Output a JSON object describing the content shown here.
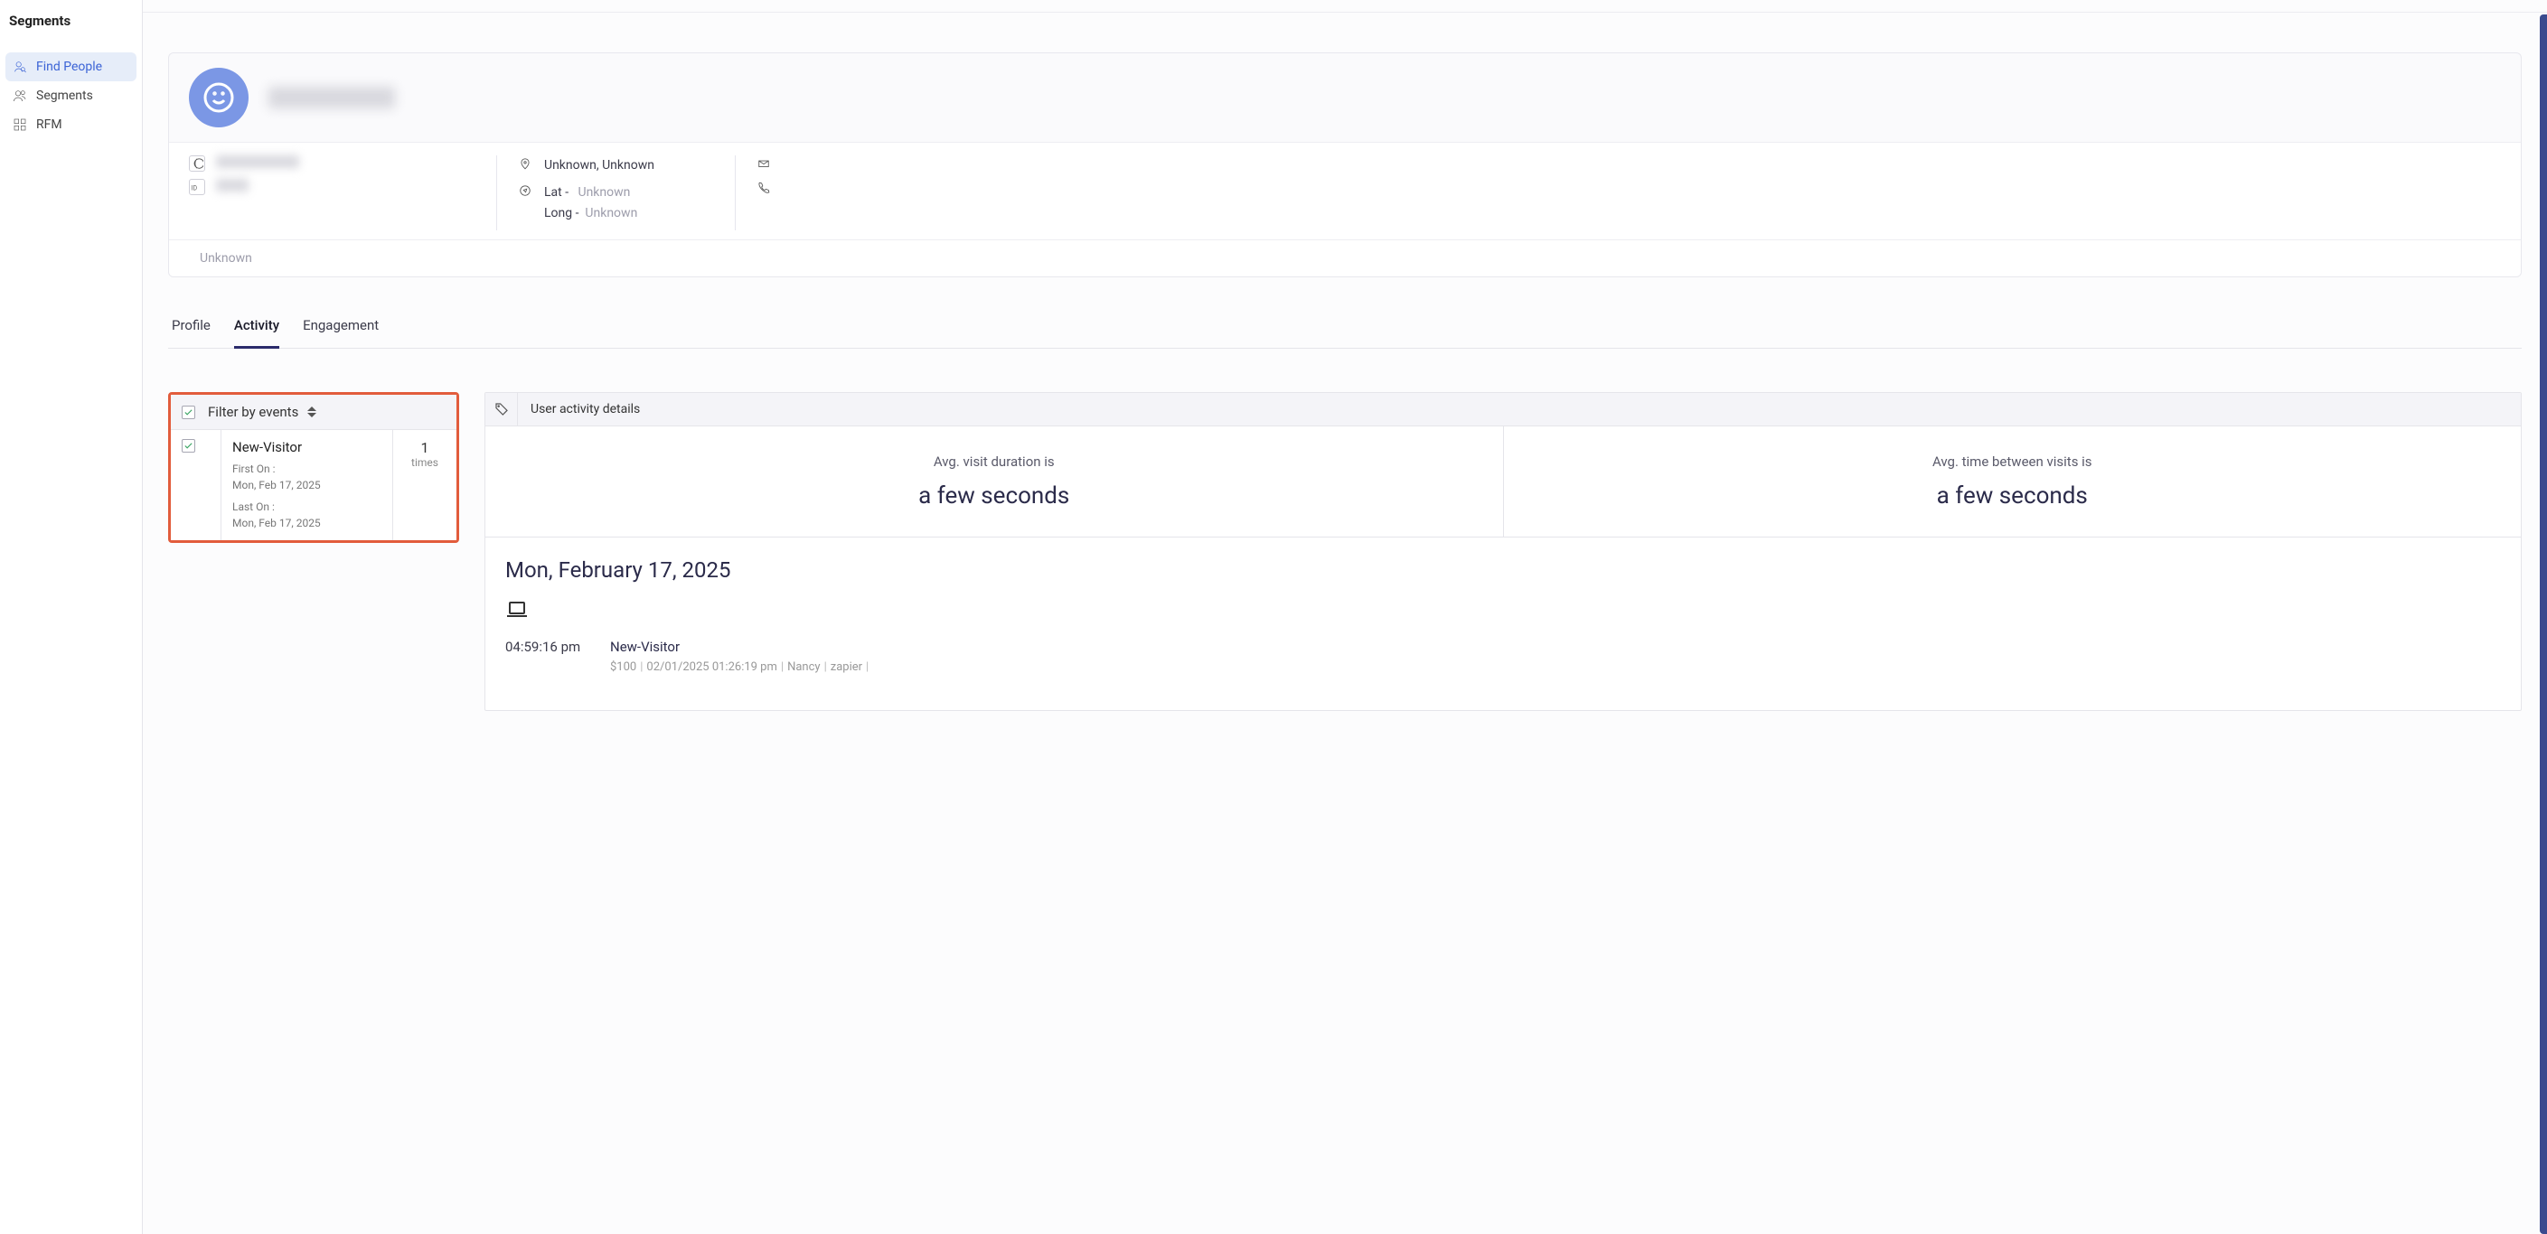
{
  "sidebar": {
    "title": "Segments",
    "items": [
      {
        "label": "Find People"
      },
      {
        "label": "Segments"
      },
      {
        "label": "RFM"
      }
    ]
  },
  "profile": {
    "location_text": "Unknown, Unknown",
    "lat_label": "Lat -",
    "lat_value": "Unknown",
    "long_label": "Long -",
    "long_value": "Unknown",
    "gender_text": "Unknown"
  },
  "tabs": [
    {
      "label": "Profile"
    },
    {
      "label": "Activity"
    },
    {
      "label": "Engagement"
    }
  ],
  "filter": {
    "title": "Filter by events",
    "event": {
      "name": "New-Visitor",
      "first_label": "First On :",
      "first_value": "Mon, Feb 17, 2025",
      "last_label": "Last On :",
      "last_value": "Mon, Feb 17, 2025",
      "count": "1",
      "count_label": "times"
    }
  },
  "details": {
    "header": "User activity details",
    "stat1_label": "Avg. visit duration is",
    "stat1_value": "a few seconds",
    "stat2_label": "Avg. time between visits is",
    "stat2_value": "a few seconds",
    "date_heading": "Mon, February 17, 2025",
    "entry": {
      "time": "04:59:16 pm",
      "name": "New-Visitor",
      "meta_amount": "$100",
      "meta_date": "02/01/2025 01:26:19 pm",
      "meta_name": "Nancy",
      "meta_source": "zapier"
    }
  }
}
